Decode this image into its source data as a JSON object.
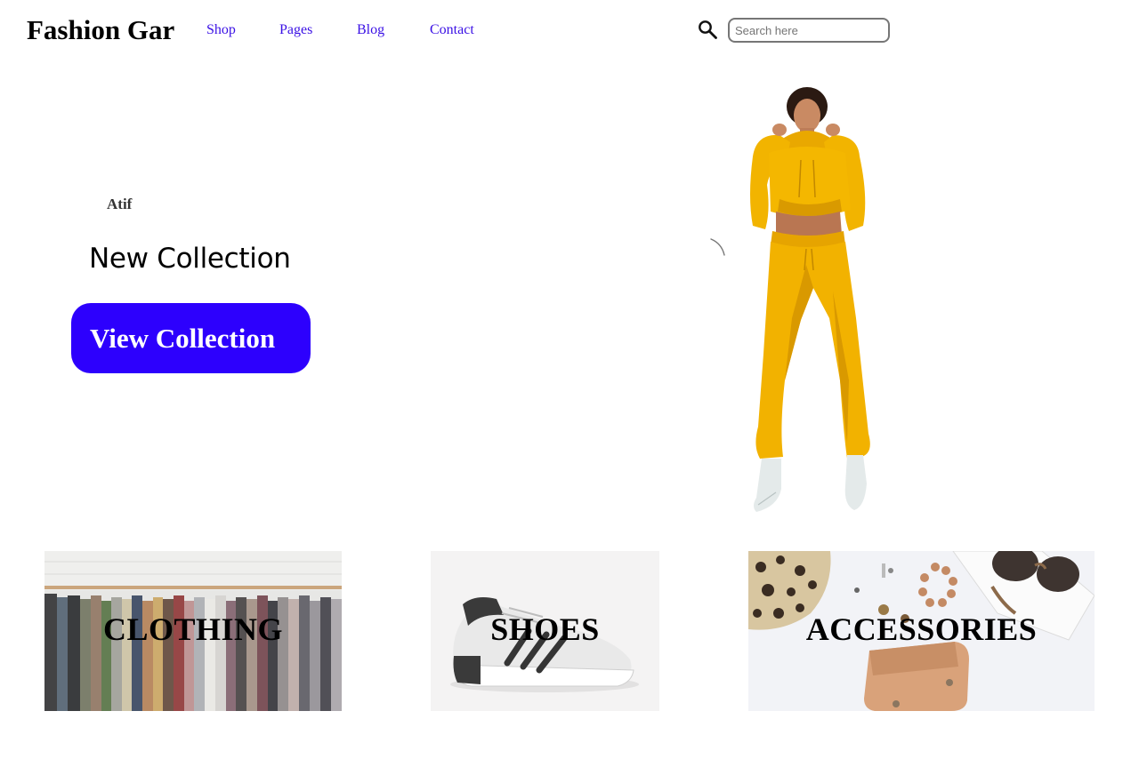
{
  "header": {
    "brand": "Fashion Gar",
    "nav": {
      "shop": "Shop",
      "pages": "Pages",
      "blog": "Blog",
      "contact": "Contact"
    },
    "search": {
      "placeholder": "Search here",
      "value": ""
    }
  },
  "hero": {
    "eyebrow": "Atif",
    "title": "New Collection",
    "button_label": "View Collection"
  },
  "categories": {
    "clothing": "CLOTHING",
    "shoes": "SHOES",
    "accessories": "ACCESSORIES"
  },
  "colors": {
    "accent": "#2d00fd",
    "nav_link": "#3a10e5",
    "outfit": "#f3b300"
  },
  "icons": {
    "search": "search-icon",
    "loading": "loading-spinner-icon"
  }
}
